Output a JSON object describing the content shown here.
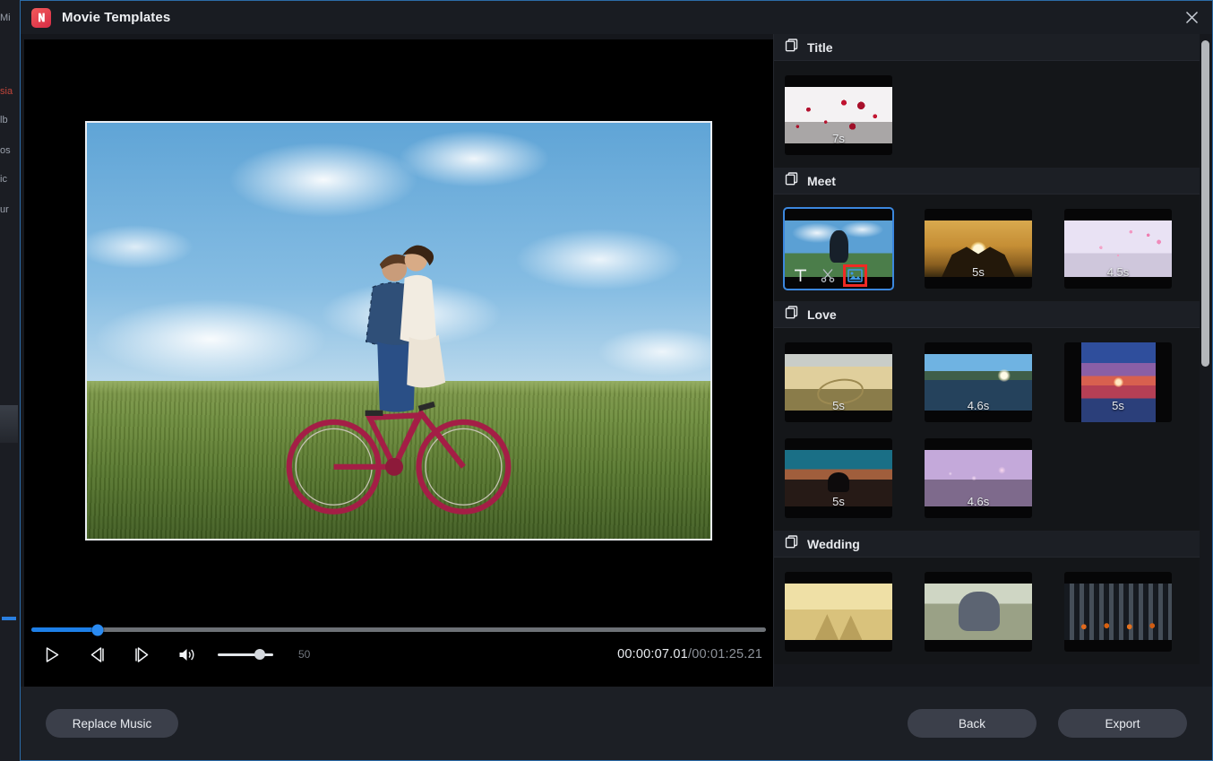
{
  "window": {
    "title": "Movie Templates",
    "app_icon": "movie-app-icon",
    "close_icon": "close-icon",
    "accent_color": "#2c6ca8",
    "app_icon_color": "#e03a4e"
  },
  "background_app": {
    "fragments": [
      "Mi",
      "sia",
      "lb",
      "os",
      "ic",
      "ur"
    ]
  },
  "preview": {
    "frame_description": "couple-on-bicycle-photo",
    "seek": {
      "position_percent": 9,
      "fill_color": "#1d7fe8"
    },
    "controls": [
      {
        "name": "play-button",
        "icon": "play-icon"
      },
      {
        "name": "previous-frame-button",
        "icon": "previous-frame-icon"
      },
      {
        "name": "next-frame-button",
        "icon": "next-frame-icon"
      },
      {
        "name": "volume-button",
        "icon": "volume-icon"
      }
    ],
    "volume": {
      "value": "50",
      "position_percent": 75
    },
    "timecode": {
      "current": "00:00:07.01",
      "separator": "/",
      "total": "00:01:25.21"
    }
  },
  "templates": {
    "scrollbar": {
      "thumb_top_percent": 1,
      "thumb_height_percent": 50
    },
    "sections": [
      {
        "name": "Title",
        "icon": "stacked-pages-icon",
        "items": [
          {
            "art": "art-petals",
            "duration": "7s",
            "selected": false,
            "shape": "wide"
          }
        ]
      },
      {
        "name": "Meet",
        "icon": "stacked-pages-icon",
        "items": [
          {
            "art": "art-cyclist",
            "duration": "",
            "selected": true,
            "shape": "wide",
            "tools": [
              {
                "name": "text-tool-icon",
                "icon": "text-T-icon",
                "highlighted": false
              },
              {
                "name": "trim-tool-icon",
                "icon": "scissors-icon",
                "highlighted": false
              },
              {
                "name": "replace-image-tool-icon",
                "icon": "image-icon",
                "highlighted": true
              }
            ]
          },
          {
            "art": "art-hands",
            "duration": "5s",
            "selected": false,
            "shape": "wide"
          },
          {
            "art": "art-sakura",
            "duration": "4.5s",
            "selected": false,
            "shape": "wide"
          }
        ]
      },
      {
        "name": "Love",
        "icon": "stacked-pages-icon",
        "items": [
          {
            "art": "art-sand-heart",
            "duration": "5s",
            "selected": false,
            "shape": "wide"
          },
          {
            "art": "art-lake",
            "duration": "4.6s",
            "selected": false,
            "shape": "wide"
          },
          {
            "art": "art-sunset-sea",
            "duration": "5s",
            "selected": false,
            "shape": "square"
          },
          {
            "art": "art-dusk-couple",
            "duration": "5s",
            "selected": false,
            "shape": "wide"
          },
          {
            "art": "art-bokeh",
            "duration": "4.6s",
            "selected": false,
            "shape": "wide"
          }
        ]
      },
      {
        "name": "Wedding",
        "icon": "stacked-pages-icon",
        "items": [
          {
            "art": "art-pyramid",
            "duration": "",
            "selected": false,
            "shape": "wide"
          },
          {
            "art": "art-wedding-couple",
            "duration": "",
            "selected": false,
            "shape": "wide"
          },
          {
            "art": "art-candles",
            "duration": "",
            "selected": false,
            "shape": "wide"
          }
        ]
      }
    ]
  },
  "footer": {
    "replace_music_label": "Replace Music",
    "back_label": "Back",
    "export_label": "Export"
  },
  "annotation": {
    "arrow_color": "#ee2a22",
    "points_at": "replace-image-tool-icon"
  }
}
